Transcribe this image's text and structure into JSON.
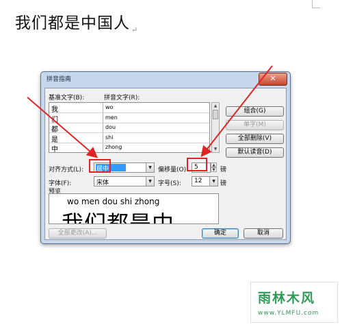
{
  "document": {
    "text": "我们都是中国人",
    "pilcrow": "↵"
  },
  "dialog": {
    "title": "拼音指南",
    "close_glyph": "✕",
    "headers": {
      "base": "基准文字(B):",
      "pinyin": "拼音文字(R):"
    },
    "rows": [
      {
        "base": "我",
        "pinyin": "wo"
      },
      {
        "base": "们",
        "pinyin": "men"
      },
      {
        "base": "都",
        "pinyin": "dou"
      },
      {
        "base": "是",
        "pinyin": "shi"
      },
      {
        "base": "中",
        "pinyin": "zhong"
      }
    ],
    "buttons": {
      "combine": "组合(G)",
      "single": "单字(M)",
      "clear_all": "全部删除(V)",
      "default_reading": "默认读音(D)",
      "change_all": "全部更改(A)...",
      "ok": "确定",
      "cancel": "取消"
    },
    "align": {
      "label": "对齐方式(L):",
      "value": "居中"
    },
    "offset": {
      "label": "偏移量(O):",
      "value": "5",
      "unit": "磅"
    },
    "font": {
      "label": "字体(F):",
      "value": "宋体"
    },
    "size": {
      "label": "字号(S):",
      "value": "12",
      "unit": "磅"
    },
    "preview": {
      "label": "预览",
      "pinyin": "wo men dou shi zhong",
      "base": "我们都是中"
    }
  },
  "watermark": {
    "brand": "雨林木风",
    "url": "www.YLMFU.com"
  },
  "colors": {
    "highlight": "#e02424",
    "selection": "#3399ff",
    "brand": "#2d9a56"
  }
}
